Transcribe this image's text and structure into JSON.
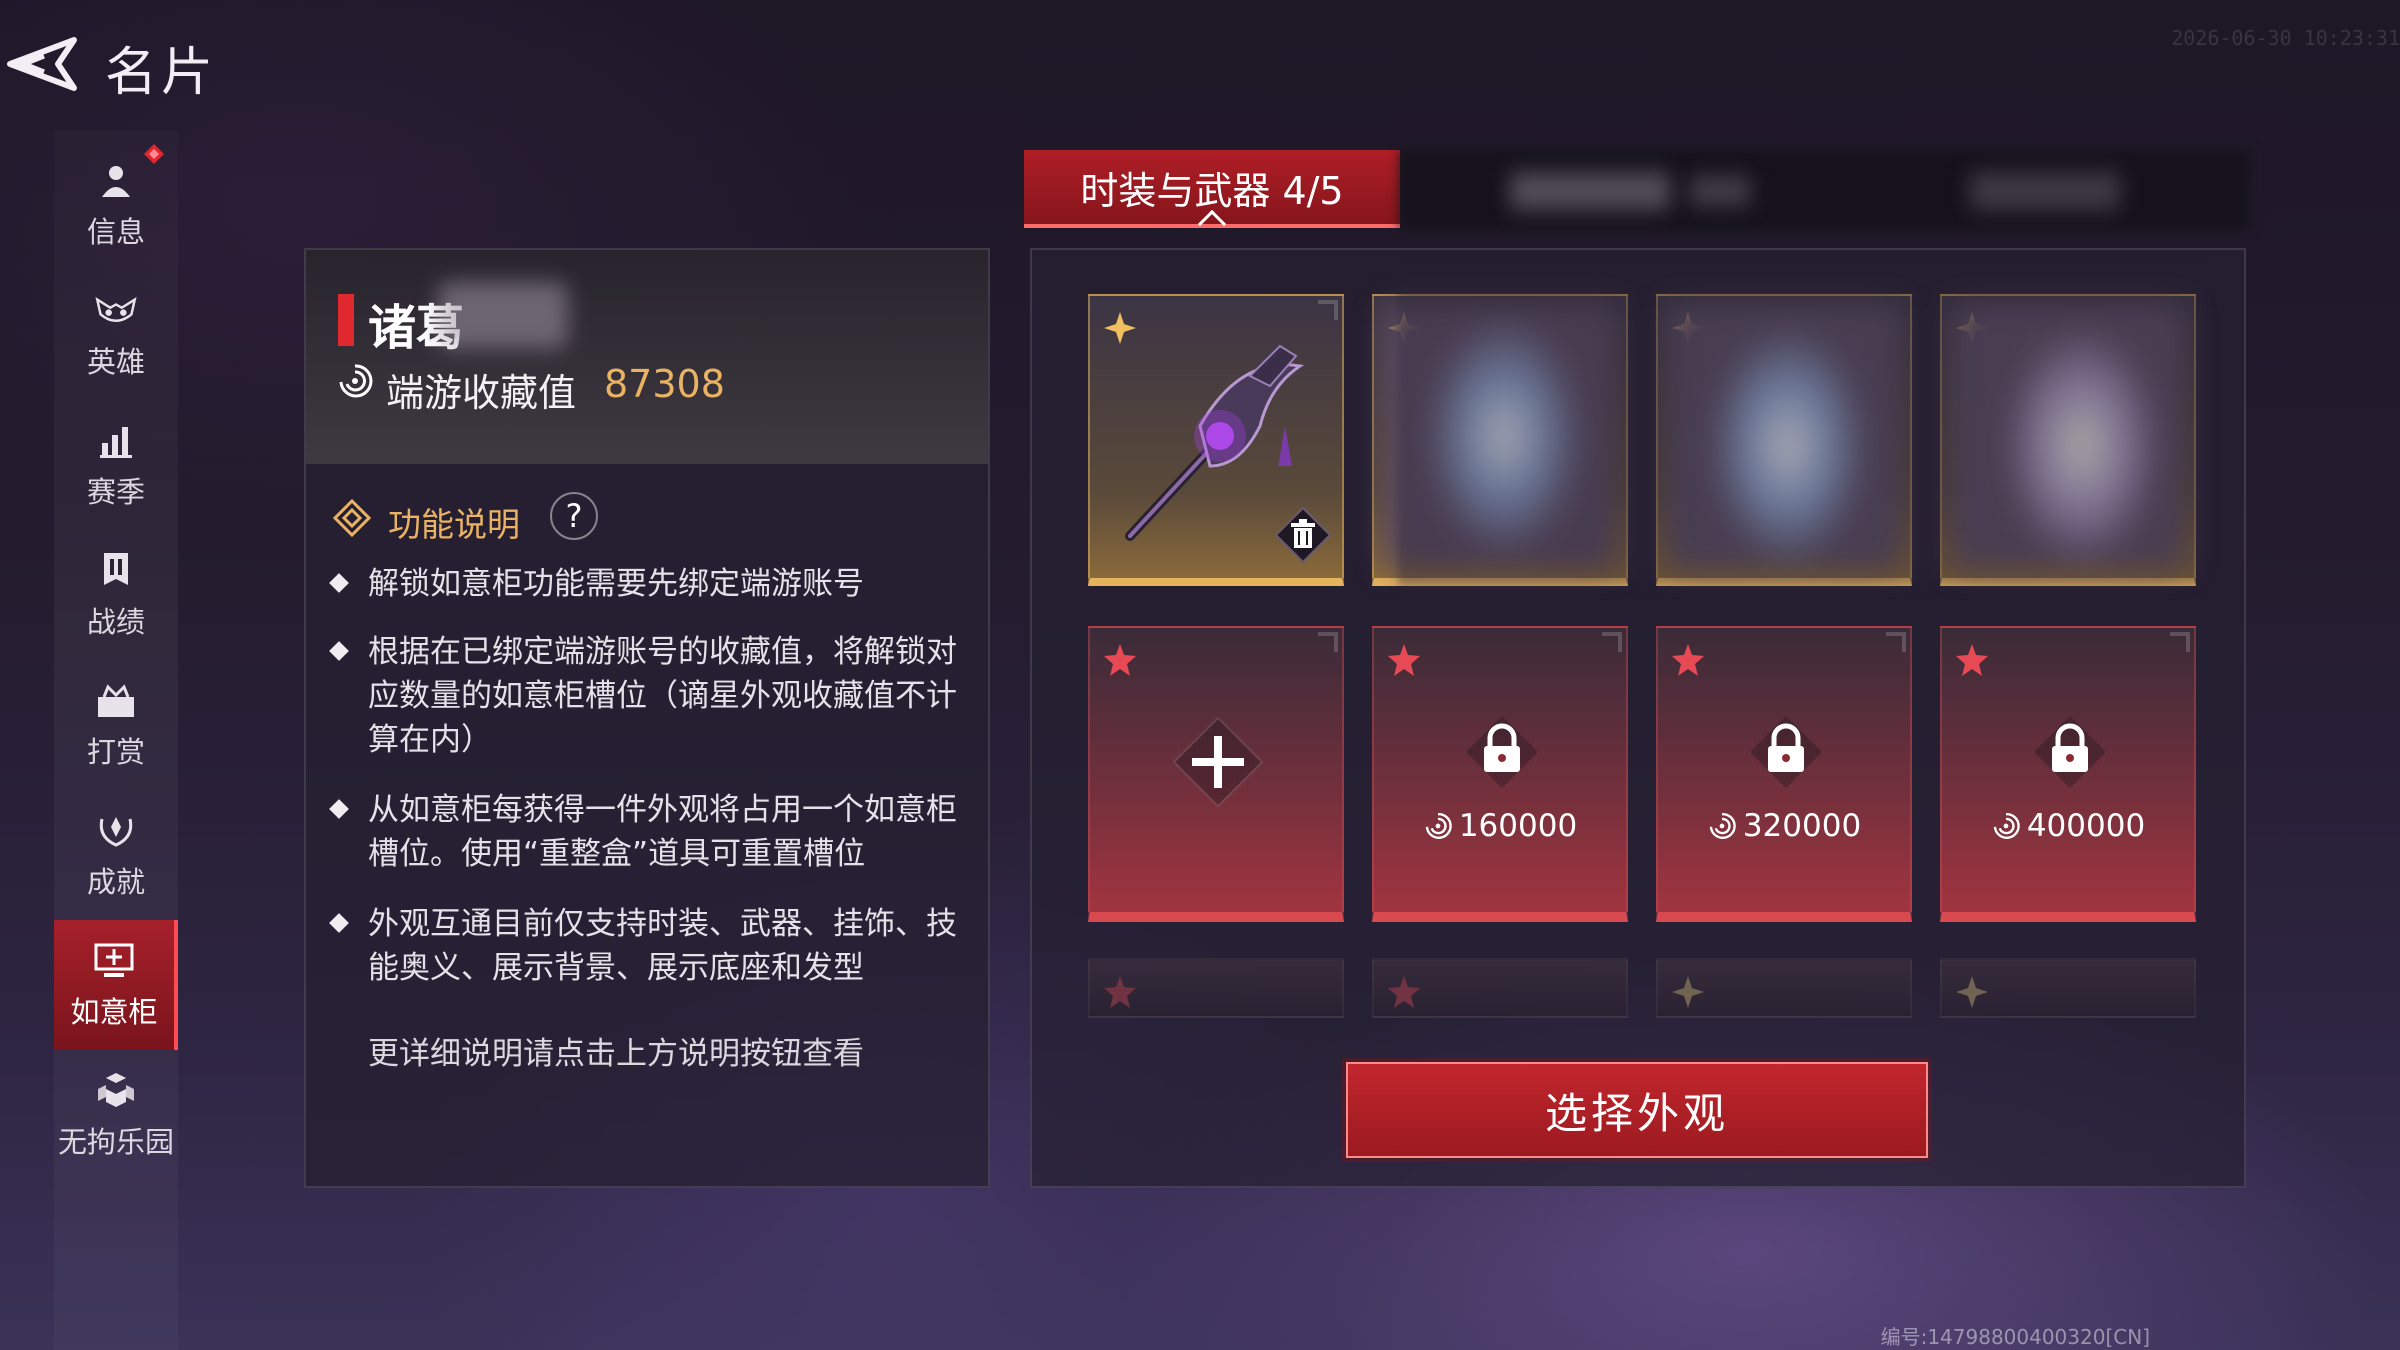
{
  "header": {
    "title": "名片",
    "timestamp": "2026-06-30 10:23:31",
    "footer_code": "编号:14798800400320[CN]"
  },
  "sidebar": {
    "items": [
      {
        "label": "信息",
        "icon": "person-icon"
      },
      {
        "label": "英雄",
        "icon": "mask-icon"
      },
      {
        "label": "赛季",
        "icon": "bar-chart-icon"
      },
      {
        "label": "战绩",
        "icon": "banner-icon"
      },
      {
        "label": "打赏",
        "icon": "gift-icon"
      },
      {
        "label": "成就",
        "icon": "laurel-icon"
      },
      {
        "label": "如意柜",
        "icon": "cabinet-icon",
        "active": true
      },
      {
        "label": "无拘乐园",
        "icon": "blocks-icon"
      }
    ]
  },
  "info_panel": {
    "player_name": "诸葛",
    "collection_label": "端游收藏值",
    "collection_value": "87308",
    "func_label": "功能说明",
    "help_symbol": "?",
    "descriptions": [
      "解锁如意柜功能需要先绑定端游账号",
      "根据在已绑定端游账号的收藏值，将解锁对应数量的如意柜槽位（谪星外观收藏值不计算在内）",
      "从如意柜每获得一件外观将占用一个如意柜槽位。使用“重整盒”道具可重置槽位",
      "外观互通目前仅支持时装、武器、挂饰、技能奥义、展示背景、展示底座和发型"
    ],
    "footer": "更详细说明请点击上方说明按钮查看"
  },
  "tabs": {
    "active_label": "时装与武器 4/5"
  },
  "slots": {
    "prices": [
      "160000",
      "320000",
      "400000"
    ]
  },
  "select_button": "选择外观",
  "colors": {
    "accent_red": "#c2262d",
    "gold": "#e5b35c",
    "value_gold": "#e9b363"
  }
}
